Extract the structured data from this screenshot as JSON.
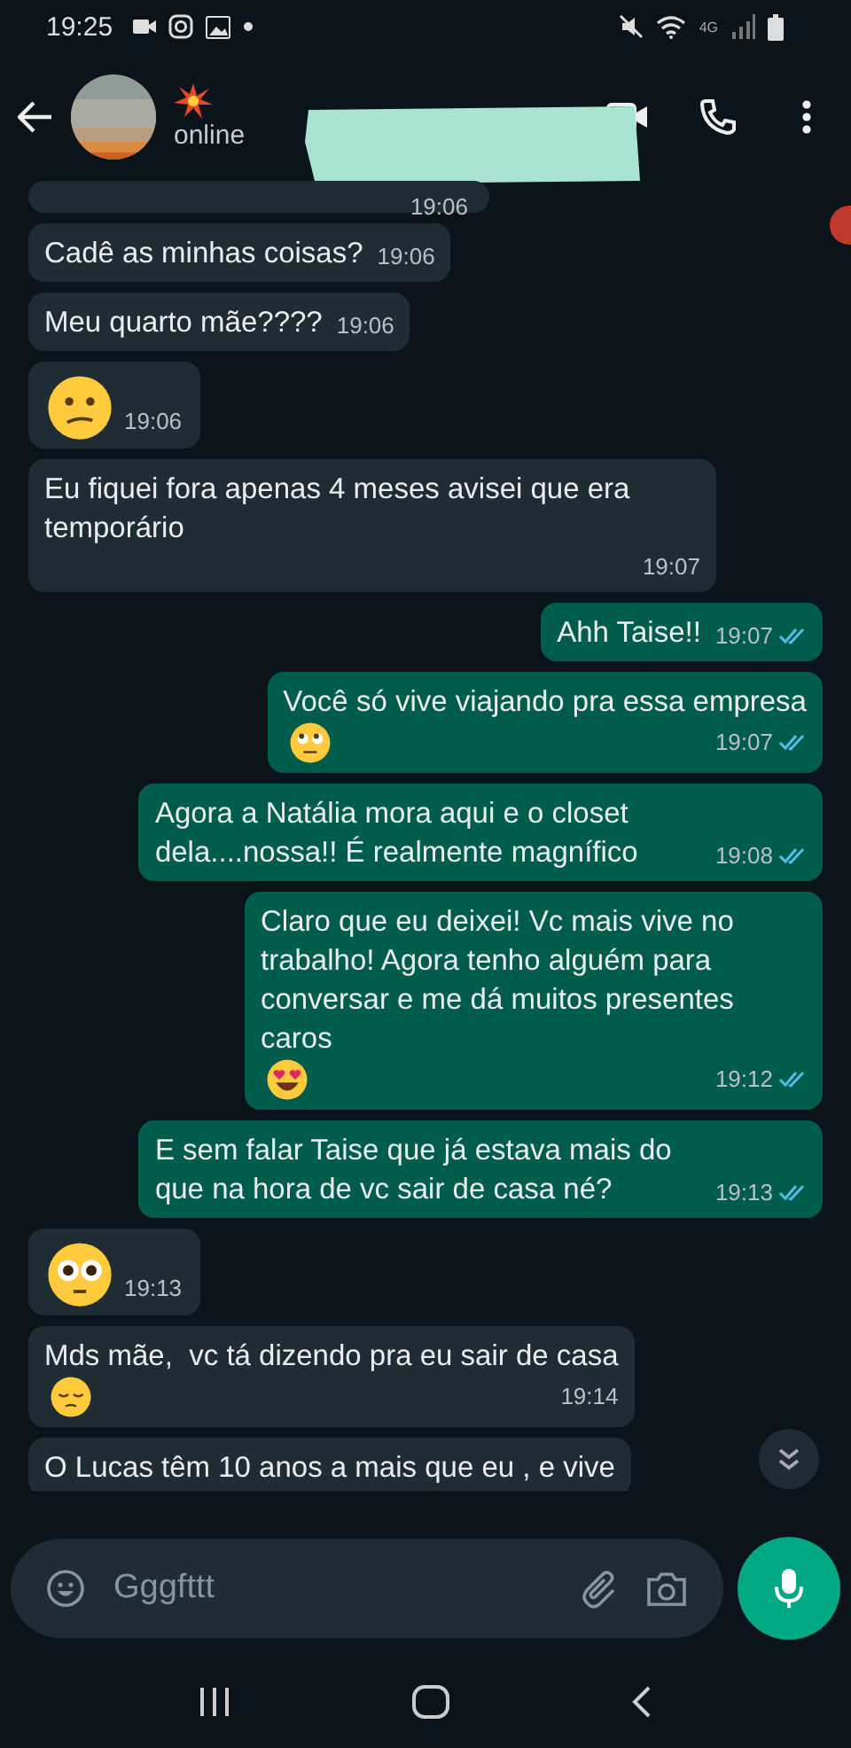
{
  "status_bar": {
    "time": "19:25",
    "network": "4G"
  },
  "header": {
    "contact_status": "online",
    "name_hidden": true
  },
  "messages": [
    {
      "outgoing": false,
      "kind": "text",
      "time": "19:06"
    },
    {
      "outgoing": false,
      "kind": "text",
      "text": "Cadê as minhas coisas?",
      "time": "19:06"
    },
    {
      "outgoing": false,
      "kind": "text",
      "text": "Meu quarto mãe????",
      "time": "19:06"
    },
    {
      "outgoing": false,
      "kind": "confused",
      "time": "19:06"
    },
    {
      "outgoing": false,
      "kind": "text",
      "text": "Eu fiquei fora apenas 4 meses avisei que era temporário",
      "time": "19:07"
    },
    {
      "outgoing": true,
      "kind": "text",
      "text": "Ahh Taise!!",
      "time": "19:07",
      "read": true
    },
    {
      "outgoing": true,
      "kind": "text",
      "text": "Você só vive viajando pra essa empresa",
      "end_emoji": {
        "kind": "eyeroll"
      },
      "time": "19:07",
      "read": true
    },
    {
      "outgoing": true,
      "kind": "text",
      "text": "Agora a Natália mora aqui e o closet dela....nossa!! É realmente magnífico",
      "time": "19:08",
      "read": true
    },
    {
      "outgoing": true,
      "kind": "text",
      "text": "Claro que eu deixei! Vc mais vive no trabalho! Agora tenho alguém para conversar e me dá muitos presentes caros",
      "end_emoji": {
        "kind": "heart-eyes"
      },
      "time": "19:12",
      "read": true
    },
    {
      "outgoing": true,
      "kind": "text",
      "text": "E sem falar Taise que já estava mais do que na hora de vc sair de casa né?",
      "time": "19:13",
      "read": true
    },
    {
      "outgoing": false,
      "kind": "flushed",
      "time": "19:13"
    },
    {
      "outgoing": false,
      "kind": "text",
      "text": "Mds mãe,  vc tá dizendo pra eu sair de casa",
      "end_emoji": {
        "kind": "pensive"
      },
      "time": "19:14"
    },
    {
      "outgoing": false,
      "kind": "text",
      "text": "O Lucas têm 10 anos a mais que eu , e vive",
      "partial": true
    }
  ],
  "composer": {
    "placeholder": "Gggfttt"
  }
}
